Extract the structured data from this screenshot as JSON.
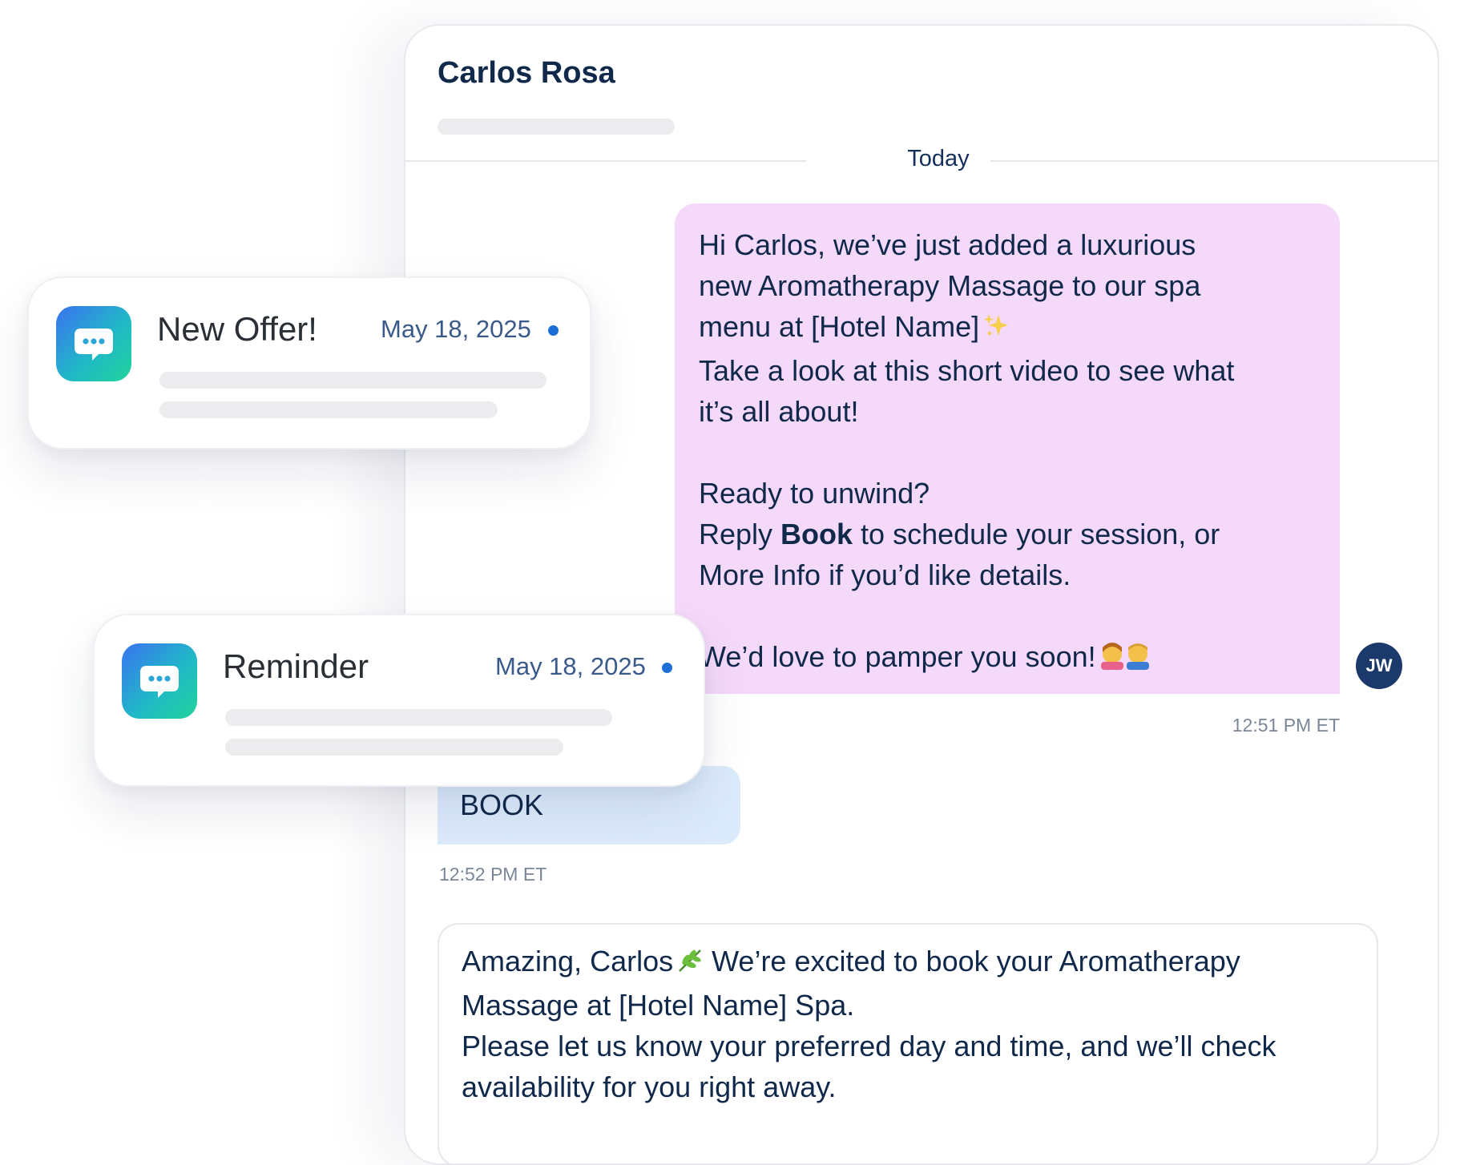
{
  "conversation": {
    "contact_name": "Carlos Rosa",
    "day_label": "Today"
  },
  "messages": {
    "outgoing": {
      "lines": [
        "Hi Carlos, we’ve just added a luxurious",
        "new Aromatherapy Massage to our spa",
        "menu at [Hotel Name]",
        "Take a look at this short video to see what",
        "it’s all about!",
        "Ready to unwind?",
        "Reply ",
        "Book",
        " to schedule your session, or",
        "More Info if you’d like details.",
        "We’d love to pamper you soon!"
      ],
      "time": "12:51 PM ET",
      "sender_initials": "JW"
    },
    "incoming": {
      "text": "BOOK",
      "time": "12:52 PM ET"
    },
    "reply": {
      "lines": [
        "Amazing, Carlos",
        " We’re excited to book your Aromatherapy",
        "Massage at [Hotel Name] Spa.",
        "Please let us know your preferred day and time, and we’ll check",
        "availability for you right away."
      ]
    }
  },
  "notifications": [
    {
      "title": "New Offer!",
      "date": "May 18, 2025",
      "unread_color": "#1b6fd6",
      "icon": "chat-bubble-icon"
    },
    {
      "title": "Reminder",
      "date": "May 18, 2025",
      "unread_color": "#1b6fd6",
      "icon": "chat-bubble-icon"
    }
  ],
  "colors": {
    "outgoing_bubble": "#f5d9fa",
    "incoming_bubble": "#dcebfc",
    "avatar": "#1b3a6b",
    "text": "#10284a"
  }
}
